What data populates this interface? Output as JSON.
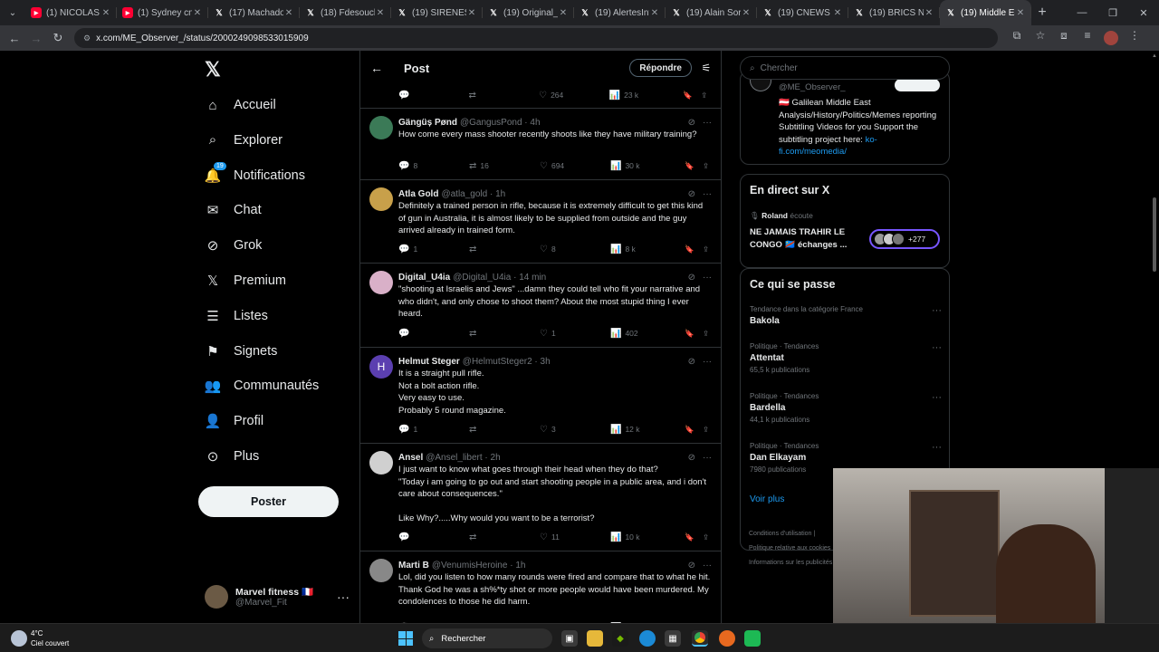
{
  "browser": {
    "tabs": [
      {
        "title": "(1) NICOLAS S...",
        "icon": "youtube-icon"
      },
      {
        "title": "(1) Sydney cne...",
        "icon": "youtube-icon"
      },
      {
        "title": "(17) Machado...",
        "icon": "x-icon"
      },
      {
        "title": "(18) Fdesouche...",
        "icon": "x-icon"
      },
      {
        "title": "(19) SIRÈNES s...",
        "icon": "x-icon"
      },
      {
        "title": "(19) Original_C...",
        "icon": "x-icon"
      },
      {
        "title": "(19) AlertesInfo...",
        "icon": "x-icon"
      },
      {
        "title": "(19) Alain Sora...",
        "icon": "x-icon"
      },
      {
        "title": "(19) CNEWS (@...",
        "icon": "x-icon"
      },
      {
        "title": "(19) BRICS Ne...",
        "icon": "x-icon"
      },
      {
        "title": "(19) Middle Ea...",
        "icon": "x-icon",
        "active": true
      }
    ],
    "url": "x.com/ME_Observer_/status/2000249098533015909"
  },
  "nav": {
    "items": [
      {
        "label": "Accueil",
        "icon": "home-icon"
      },
      {
        "label": "Explorer",
        "icon": "search-icon"
      },
      {
        "label": "Notifications",
        "icon": "bell-icon",
        "badge": "19"
      },
      {
        "label": "Chat",
        "icon": "mail-icon"
      },
      {
        "label": "Grok",
        "icon": "grok-icon"
      },
      {
        "label": "Premium",
        "icon": "x-premium-icon"
      },
      {
        "label": "Listes",
        "icon": "list-icon"
      },
      {
        "label": "Signets",
        "icon": "bookmark-icon"
      },
      {
        "label": "Communautés",
        "icon": "communities-icon"
      },
      {
        "label": "Profil",
        "icon": "profile-icon"
      },
      {
        "label": "Plus",
        "icon": "more-circle-icon"
      }
    ],
    "post_label": "Poster",
    "account": {
      "name": "Marvel fitness 🇫🇷",
      "handle": "@Marvel_Fit"
    }
  },
  "center": {
    "header_title": "Post",
    "reply_label": "Répondre",
    "top_actions": {
      "replies": "",
      "retweets": "",
      "likes": "264",
      "views": "23 k"
    },
    "tweets": [
      {
        "name": "Gängüș Pønd",
        "handle": "@GangusPond · 4h",
        "avatar_color": "#3b7a57",
        "text": "How come every mass shooter recently shoots like they have military training?",
        "replies": "8",
        "retweets": "16",
        "likes": "694",
        "views": "30 k"
      },
      {
        "name": "Atla Gold",
        "handle": "@atla_gold · 1h",
        "avatar_color": "#c8a04a",
        "text": "Definitely a trained person in rifle, because it is extremely difficult to get this kind of gun in Australia, it is almost likely to be supplied from outside and the guy arrived already in trained form.",
        "replies": "1",
        "retweets": "",
        "likes": "8",
        "views": "8 k"
      },
      {
        "name": "Digital_U4ia",
        "handle": "@Digital_U4ia · 14 min",
        "avatar_color": "#d9b0c8",
        "text": "\"shooting at Israelis and Jews\" ...damn they could tell who fit your narrative and who didn't, and only chose to shoot them? About the most stupid thing I ever heard.",
        "replies": "",
        "retweets": "",
        "likes": "1",
        "views": "402"
      },
      {
        "name": "Helmut Steger",
        "handle": "@HelmutSteger2 · 3h",
        "avatar_color": "#5b3fb0",
        "avatar_letter": "H",
        "text": "It is a straight pull rifle.\nNot a bolt action rifle.\nVery easy to use.\nProbably 5 round magazine.",
        "replies": "1",
        "retweets": "",
        "likes": "3",
        "views": "12 k"
      },
      {
        "name": "Ansel",
        "handle": "@Ansel_libert · 2h",
        "avatar_color": "#d0d0d0",
        "text": "I just want to know what goes through their head when they do that?\n\"Today i am going to go out and start shooting people in a public area, and i don't care about consequences.\"\n\nLike Why?.....Why would you want to be a terrorist?",
        "replies": "",
        "retweets": "",
        "likes": "11",
        "views": "10 k"
      },
      {
        "name": "Marti B",
        "handle": "@VenumisHeroine · 1h",
        "avatar_color": "#888",
        "text": "Lol, did you listen to how many rounds were fired and compare that to what he hit. Thank God he was a sh%*ty shot or more people would have been murdered.  My condolences to those he did harm.",
        "replies": "",
        "retweets": "",
        "likes": "",
        "views": "2 k"
      }
    ]
  },
  "right": {
    "search_placeholder": "Chercher",
    "profile": {
      "handle": "@ME_Observer_",
      "bio": "🇦🇹 Galilean Middle East Analysis/History/Politics/Memes reporting Subtitling Videos for you Support the subtitling project here: ",
      "link": "ko-fi.com/meomedia/"
    },
    "live": {
      "title": "En direct sur X",
      "host": "Roland",
      "host_suffix": " écoute",
      "space_title": "NE JAMAIS TRAHIR LE CONGO 🇨🇩 échanges ...",
      "listeners": "+277"
    },
    "trends": {
      "title": "Ce qui se passe",
      "items": [
        {
          "context": "Tendance dans la catégorie France",
          "name": "Bakola",
          "count": ""
        },
        {
          "context": "Politique · Tendances",
          "name": "Attentat",
          "count": "65,5 k publications"
        },
        {
          "context": "Politique · Tendances",
          "name": "Bardella",
          "count": "44,1 k publications"
        },
        {
          "context": "Politique · Tendances",
          "name": "Dan Elkayam",
          "count": "7980 publications"
        }
      ],
      "see_more": "Voir plus"
    },
    "footer": [
      "Conditions d'utilisation |",
      "Politique relative aux cookies",
      "Informations sur les publicités"
    ]
  },
  "taskbar": {
    "temp": "4°C",
    "weather": "Ciel couvert",
    "search": "Rechercher"
  }
}
